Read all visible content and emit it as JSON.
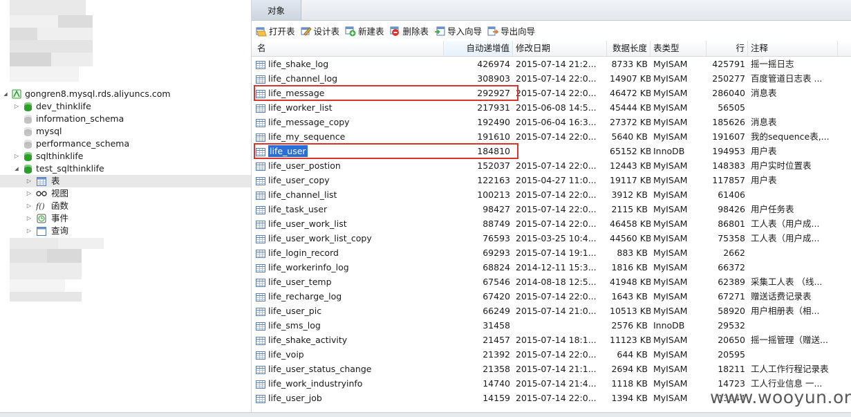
{
  "tree": {
    "connection": "gongren8.mysql.rds.aliyuncs.com",
    "databases": [
      {
        "name": "dev_thinklife",
        "state": "collapsed",
        "active": true
      },
      {
        "name": "information_schema",
        "state": "none",
        "active": false
      },
      {
        "name": "mysql",
        "state": "none",
        "active": false
      },
      {
        "name": "performance_schema",
        "state": "none",
        "active": false
      },
      {
        "name": "sqlthinklife",
        "state": "collapsed",
        "active": true
      },
      {
        "name": "test_sqlthinklife",
        "state": "expanded",
        "active": true
      }
    ],
    "children": [
      {
        "label": "表",
        "icon": "table-icon",
        "selected": true
      },
      {
        "label": "视图",
        "icon": "glasses-icon",
        "selected": false
      },
      {
        "label": "函数",
        "icon": "function-icon",
        "selected": false
      },
      {
        "label": "事件",
        "icon": "clock-icon",
        "selected": false
      },
      {
        "label": "查询",
        "icon": "query-icon",
        "selected": false
      }
    ]
  },
  "tab": {
    "label": "对象"
  },
  "toolbar": [
    {
      "label": "打开表",
      "icon": "open-table-icon"
    },
    {
      "label": "设计表",
      "icon": "design-table-icon"
    },
    {
      "label": "新建表",
      "icon": "new-table-icon"
    },
    {
      "label": "删除表",
      "icon": "delete-table-icon"
    },
    {
      "label": "导入向导",
      "icon": "import-wizard-icon"
    },
    {
      "label": "导出向导",
      "icon": "export-wizard-icon"
    }
  ],
  "columns": [
    "名",
    "自动递增值",
    "修改日期",
    "数据长度",
    "表类型",
    "行",
    "注释"
  ],
  "rows": [
    {
      "name": "life_shake_log",
      "auto": "426974",
      "date": "2015-07-14 21:2...",
      "size": "8733 KB",
      "type": "MyISAM",
      "rows": "425791",
      "comment": "摇一摇日志"
    },
    {
      "name": "life_channel_log",
      "auto": "308903",
      "date": "2015-07-14 22:0...",
      "size": "14907 KB",
      "type": "MyISAM",
      "rows": "250277",
      "comment": "百度管道日志表 ..."
    },
    {
      "name": "life_message",
      "auto": "292927",
      "date": "2015-07-14 22:0...",
      "size": "46472 KB",
      "type": "MyISAM",
      "rows": "286040",
      "comment": "消息表"
    },
    {
      "name": "life_worker_list",
      "auto": "217931",
      "date": "2015-06-08 14:5...",
      "size": "45444 KB",
      "type": "MyISAM",
      "rows": "56505",
      "comment": ""
    },
    {
      "name": "life_message_copy",
      "auto": "192490",
      "date": "2015-06-04 16:3...",
      "size": "27372 KB",
      "type": "MyISAM",
      "rows": "185626",
      "comment": "消息表"
    },
    {
      "name": "life_my_sequence",
      "auto": "191610",
      "date": "2015-07-14 22:0...",
      "size": "5640 KB",
      "type": "MyISAM",
      "rows": "191607",
      "comment": "我的sequence表,..."
    },
    {
      "name": "life_user",
      "auto": "184810",
      "date": "",
      "size": "65152 KB",
      "type": "InnoDB",
      "rows": "194953",
      "comment": "用户表"
    },
    {
      "name": "life_user_postion",
      "auto": "152037",
      "date": "2015-07-14 22:0...",
      "size": "12443 KB",
      "type": "MyISAM",
      "rows": "148383",
      "comment": "用户实时位置表"
    },
    {
      "name": "life_user_copy",
      "auto": "122163",
      "date": "2015-04-27 11:0...",
      "size": "19117 KB",
      "type": "MyISAM",
      "rows": "117857",
      "comment": "用户表"
    },
    {
      "name": "life_channel_list",
      "auto": "100213",
      "date": "2015-07-14 22:0...",
      "size": "3912 KB",
      "type": "MyISAM",
      "rows": "61406",
      "comment": ""
    },
    {
      "name": "life_task_user",
      "auto": "98427",
      "date": "2015-07-14 22:0...",
      "size": "2115 KB",
      "type": "MyISAM",
      "rows": "98426",
      "comment": "用户任务表"
    },
    {
      "name": "life_user_work_list",
      "auto": "88749",
      "date": "2015-07-14 22:0...",
      "size": "46458 KB",
      "type": "MyISAM",
      "rows": "86801",
      "comment": "工人表（用户成..."
    },
    {
      "name": "life_user_work_list_copy",
      "auto": "76593",
      "date": "2015-03-25 10:4...",
      "size": "44560 KB",
      "type": "MyISAM",
      "rows": "75358",
      "comment": "工人表（用户成..."
    },
    {
      "name": "life_login_record",
      "auto": "69293",
      "date": "2015-07-14 19:1...",
      "size": "883 KB",
      "type": "MyISAM",
      "rows": "2662",
      "comment": ""
    },
    {
      "name": "life_workerinfo_log",
      "auto": "68824",
      "date": "2014-12-11 15:3...",
      "size": "1816 KB",
      "type": "MyISAM",
      "rows": "66372",
      "comment": ""
    },
    {
      "name": "life_user_temp",
      "auto": "67546",
      "date": "2014-08-18 12:5...",
      "size": "41948 KB",
      "type": "MyISAM",
      "rows": "62389",
      "comment": "采集工人表 （线..."
    },
    {
      "name": "life_recharge_log",
      "auto": "67420",
      "date": "2015-07-14 22:0...",
      "size": "1643 KB",
      "type": "MyISAM",
      "rows": "67271",
      "comment": "赠送话费记录表"
    },
    {
      "name": "life_user_pic",
      "auto": "66249",
      "date": "2015-07-14 21:0...",
      "size": "10513 KB",
      "type": "MyISAM",
      "rows": "58920",
      "comment": "用户相册表（相..."
    },
    {
      "name": "life_sms_log",
      "auto": "31458",
      "date": "",
      "size": "2576 KB",
      "type": "InnoDB",
      "rows": "29532",
      "comment": ""
    },
    {
      "name": "life_shake_activity",
      "auto": "21457",
      "date": "2015-07-14 18:1...",
      "size": "11123 KB",
      "type": "MyISAM",
      "rows": "20650",
      "comment": "摇一摇管理（赠送..."
    },
    {
      "name": "life_voip",
      "auto": "21392",
      "date": "2015-07-14 22:0...",
      "size": "644 KB",
      "type": "MyISAM",
      "rows": "20595",
      "comment": ""
    },
    {
      "name": "life_user_status_change",
      "auto": "21358",
      "date": "2015-07-14 21:1...",
      "size": "2694 KB",
      "type": "MyISAM",
      "rows": "18211",
      "comment": "工人工作行程记录表"
    },
    {
      "name": "life_work_industryinfo",
      "auto": "14740",
      "date": "2015-07-14 21:4...",
      "size": "1118 KB",
      "type": "MyISAM",
      "rows": "14723",
      "comment": "工人行业信息 一..."
    },
    {
      "name": "life_user_job",
      "auto": "14159",
      "date": "2015-07-14 22:0...",
      "size": "1394 KB",
      "type": "MyISAM",
      "rows": "13944",
      "comment": ""
    }
  ],
  "selected_row": "life_user",
  "highlighted_rows": [
    "life_message",
    "life_user"
  ],
  "watermark": "www.wooyun.org",
  "colors": {
    "selection": "#2b6fd4",
    "highlight_box": "#d9342b",
    "db_active": "#2f9d2f"
  }
}
